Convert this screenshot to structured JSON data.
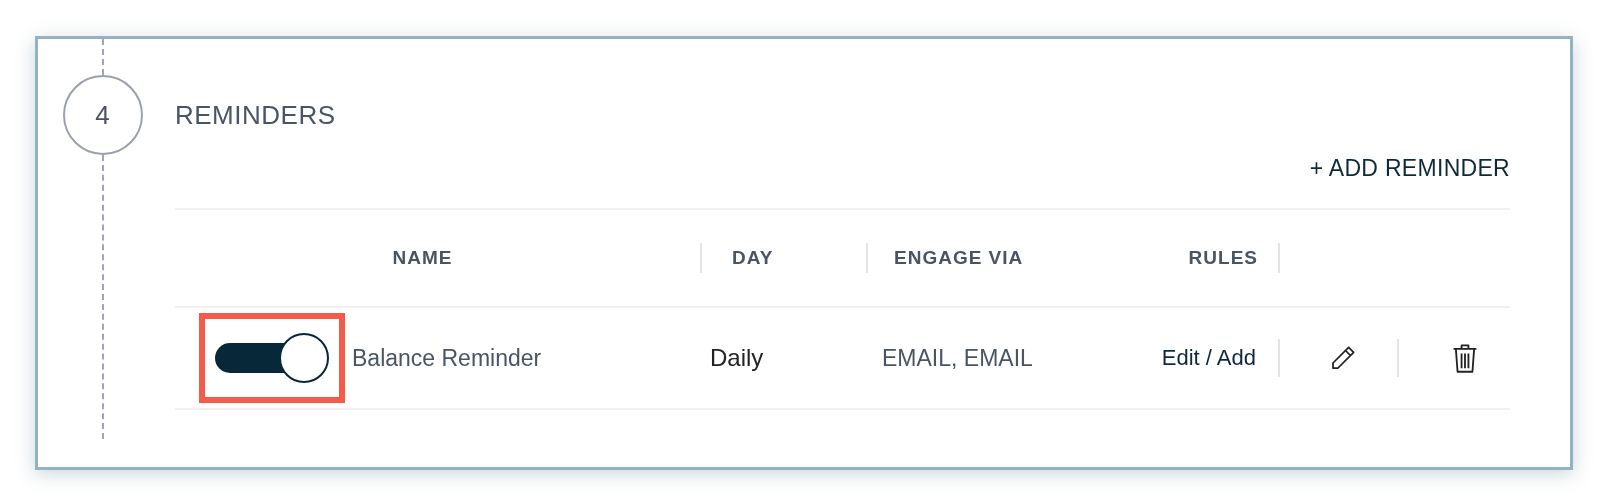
{
  "step": {
    "number": "4",
    "title": "REMINDERS"
  },
  "add_button": "+ ADD REMINDER",
  "table": {
    "columns": [
      "NAME",
      "DAY",
      "ENGAGE VIA",
      "RULES"
    ],
    "rows": [
      {
        "enabled": true,
        "highlighted": true,
        "name": "Balance Reminder",
        "day": "Daily",
        "engage_via": "EMAIL, EMAIL",
        "rules": "Edit / Add"
      }
    ]
  }
}
